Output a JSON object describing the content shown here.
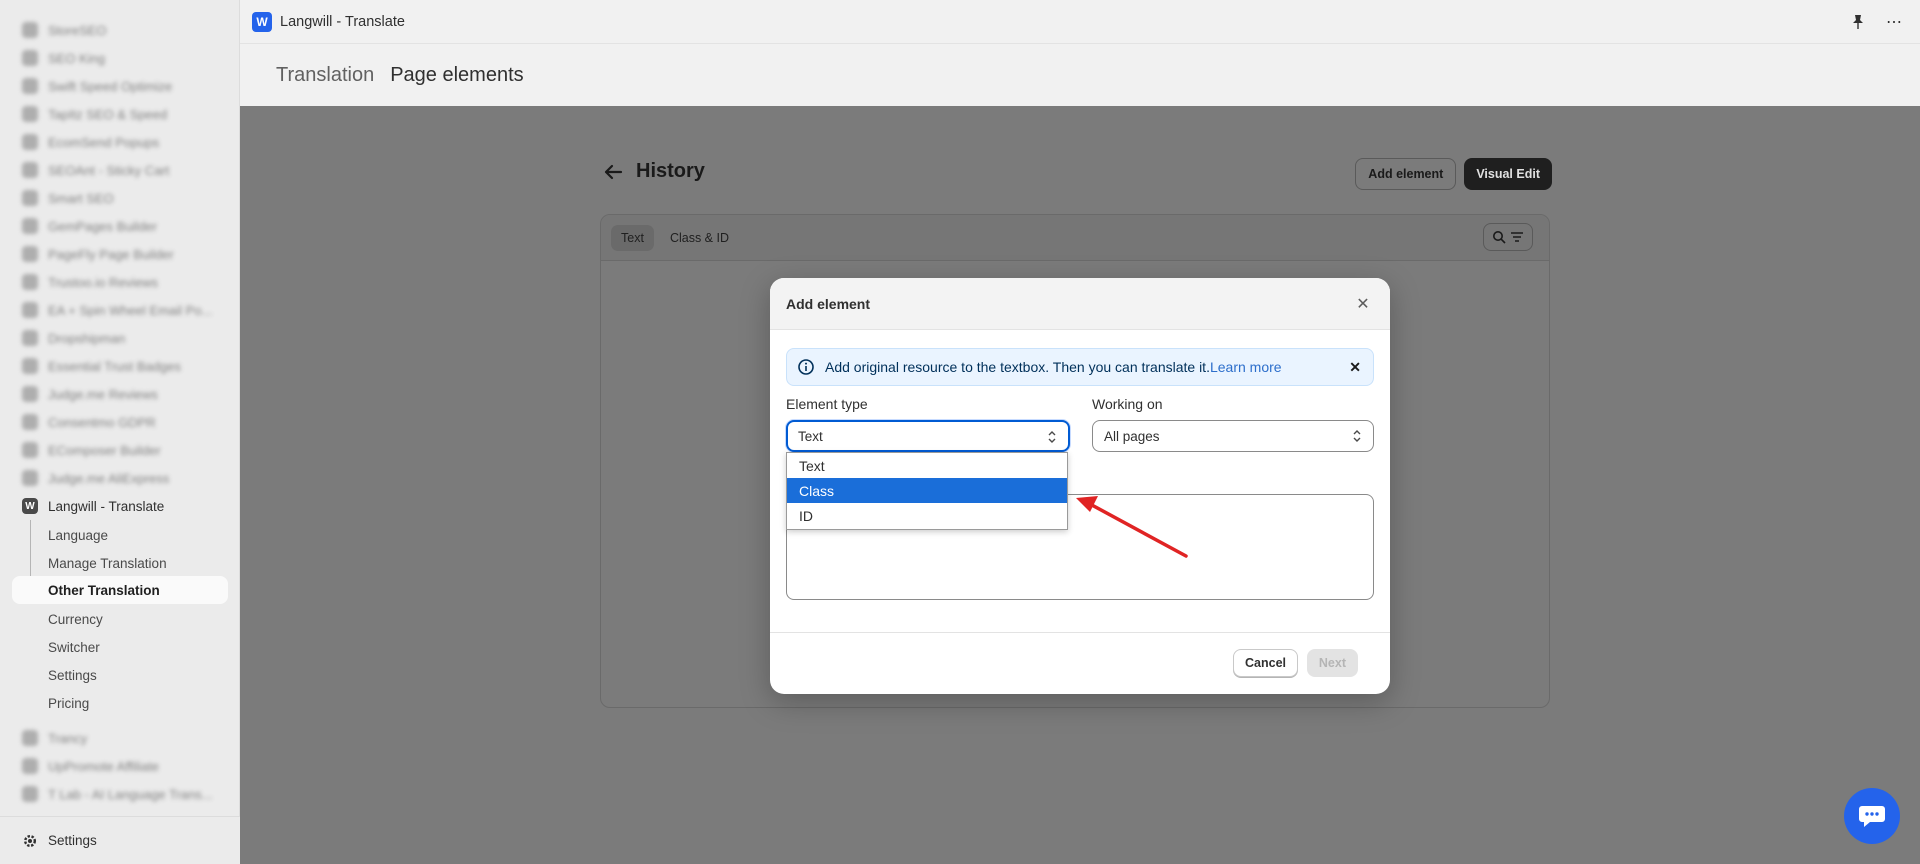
{
  "window": {
    "title": "Langwill - Translate"
  },
  "sidebar": {
    "blurred_apps": [
      "StoreSEO",
      "SEO King",
      "Swift Speed Optimize",
      "TapItz SEO & Speed",
      "EcomSend Popups",
      "SEOAnt - Sticky Cart",
      "Smart SEO",
      "GemPages Builder",
      "PageFly Page Builder",
      "Trustoo.io Reviews",
      "EA + Spin Wheel Email Po...",
      "Dropshipman",
      "Essential Trust Badges",
      "Judge.me Reviews",
      "Consentmo GDPR",
      "EComposer Builder",
      "Judge.me AliExpress"
    ],
    "active_app": "Langwill - Translate",
    "sub_items": [
      "Language",
      "Manage Translation",
      "Other Translation",
      "Currency",
      "Switcher",
      "Settings",
      "Pricing"
    ],
    "active_sub": "Other Translation",
    "blurred_apps_bottom": [
      "Trancy",
      "UpPromote Affiliate",
      "T Lab - AI Language Trans..."
    ],
    "bottom_settings": "Settings"
  },
  "nav": {
    "tabs": [
      "Translation",
      "Page elements"
    ]
  },
  "page": {
    "title": "History",
    "add_element_label": "Add element",
    "visual_edit_label": "Visual Edit",
    "card_tabs": [
      "Text",
      "Class & ID"
    ]
  },
  "modal": {
    "title": "Add element",
    "banner_text": "Add original resource to the textbox. Then you can translate it.",
    "banner_link": "Learn more",
    "element_type_label": "Element type",
    "element_type_value": "Text",
    "working_on_label": "Working on",
    "working_on_value": "All pages",
    "dropdown_options": [
      "Text",
      "Class",
      "ID"
    ],
    "highlighted_option": "Class",
    "cancel_label": "Cancel",
    "next_label": "Next"
  },
  "colors": {
    "accent": "#005bd3",
    "highlight": "#1a6ed9",
    "annotation": "#e02424",
    "chat": "#2463eb"
  }
}
